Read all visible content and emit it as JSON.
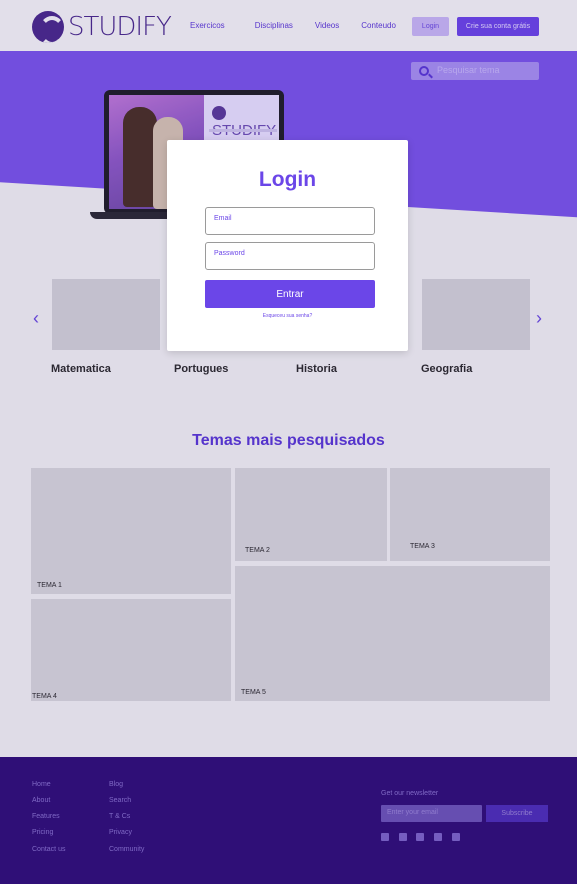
{
  "header": {
    "logo_text": "STUDIFY",
    "nav": [
      "Exercicos",
      "Disciplinas",
      "Videos",
      "Conteudo"
    ],
    "login_label": "Login",
    "signup_label": "Crie sua conta grátis"
  },
  "hero": {
    "search_placeholder": "Pesquisar tema",
    "laptop_logo_text": "STUDIFY"
  },
  "subjects": {
    "cards": [
      "Matematica",
      "Portugues",
      "Historia",
      "Geografia"
    ],
    "prev_icon": "chevron-left-icon",
    "next_icon": "chevron-right-icon"
  },
  "temas": {
    "title": "Temas mais pesquisados",
    "tiles": [
      "TEMA 1",
      "TEMA 2",
      "TEMA 3",
      "TEMA 4",
      "TEMA 5"
    ]
  },
  "footer": {
    "col1": [
      "Home",
      "About",
      "Features",
      "Pricing",
      "Contact us"
    ],
    "col2": [
      "Blog",
      "Search",
      "T & Cs",
      "Privacy",
      "Community"
    ],
    "newsletter_title": "Get our newsletter",
    "newsletter_placeholder": "Enter your email",
    "subscribe_label": "Subscribe",
    "social_icons": [
      "facebook-icon",
      "instagram-icon",
      "snapchat-icon",
      "twitter-icon",
      "youtube-icon"
    ]
  },
  "modal": {
    "title": "Login",
    "email_label": "Email",
    "password_label": "Password",
    "submit_label": "Entrar",
    "forgot_label": "Esqueceu sua senha?"
  },
  "colors": {
    "primary": "#6b46e8",
    "hero": "#7a55ea",
    "footer": "#2f0f78"
  }
}
